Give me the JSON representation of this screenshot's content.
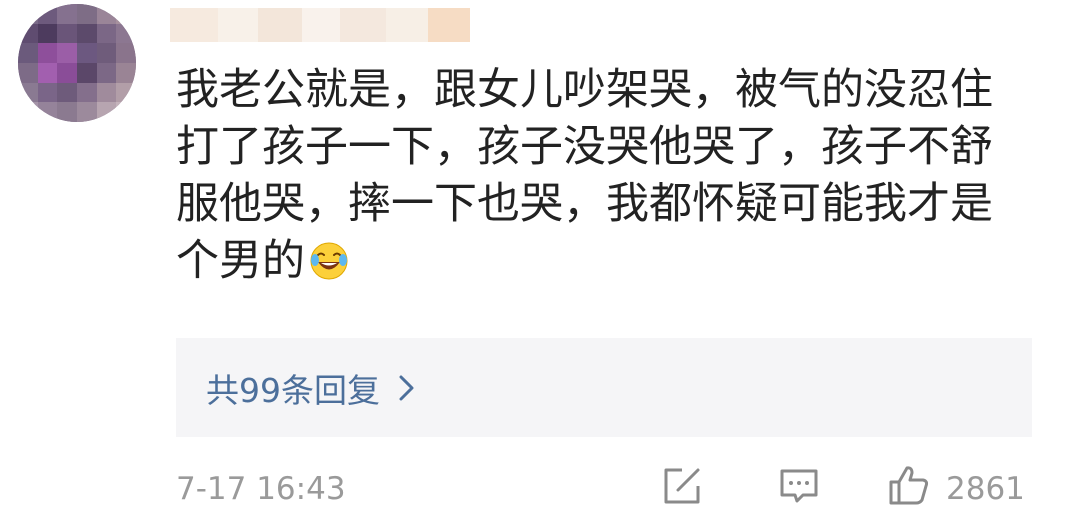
{
  "comment": {
    "text_lines": [
      "我老公就是，跟女儿吵架哭，被气的没忍住",
      "打了孩子一下，孩子没哭他哭了，孩子不舒",
      "服他哭，摔一下也哭，我都怀疑可能我才是",
      "个男的"
    ],
    "emoji": "laughing-with-tears-emoji"
  },
  "replies": {
    "label": "共99条回复"
  },
  "footer": {
    "timestamp": "7-17 16:43",
    "like_count": "2861"
  },
  "colors": {
    "text": "#222222",
    "reply_link": "#4c6f9b",
    "reply_bg": "#f5f5f7",
    "meta": "#9a9a9a"
  },
  "icons": {
    "share": "share-icon",
    "comment": "comment-icon",
    "like": "thumbs-up-icon",
    "chevron": "chevron-right-icon"
  }
}
